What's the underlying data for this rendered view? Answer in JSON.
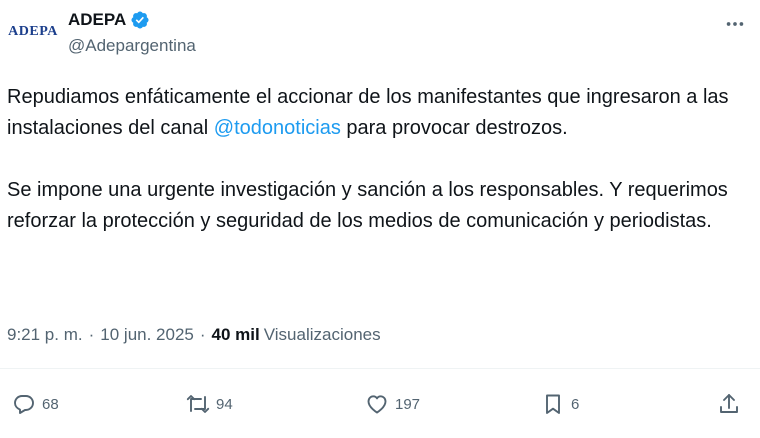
{
  "author": {
    "avatar_text": "ADEPA",
    "display_name": "ADEPA",
    "handle": "@Adepargentina",
    "verified": true
  },
  "tweet": {
    "para1_before": "Repudiamos enfáticamente el accionar de los manifestantes que ingresaron a las instalaciones del canal ",
    "mention": "@todonoticias",
    "para1_after": " para provocar destrozos.",
    "para2": "Se impone una urgente investigación y sanción a los responsables. Y requerimos reforzar la protección y seguridad de los medios de comunicación y periodistas."
  },
  "meta": {
    "time": "9:21 p. m.",
    "separator": "·",
    "date": "10 jun. 2025",
    "views_count": "40 mil",
    "views_label": "Visualizaciones"
  },
  "actions": {
    "replies": "68",
    "reposts": "94",
    "likes": "197",
    "bookmarks": "6"
  },
  "icons": {
    "verified": "verified-badge-icon",
    "more": "more-icon",
    "reply": "reply-icon",
    "repost": "repost-icon",
    "like": "heart-icon",
    "bookmark": "bookmark-icon",
    "share": "share-icon"
  },
  "colors": {
    "accent": "#1d9bf0",
    "text": "#0f1419",
    "secondary": "#536471",
    "divider": "#eff3f4",
    "avatar_text": "#1c3f8c"
  }
}
